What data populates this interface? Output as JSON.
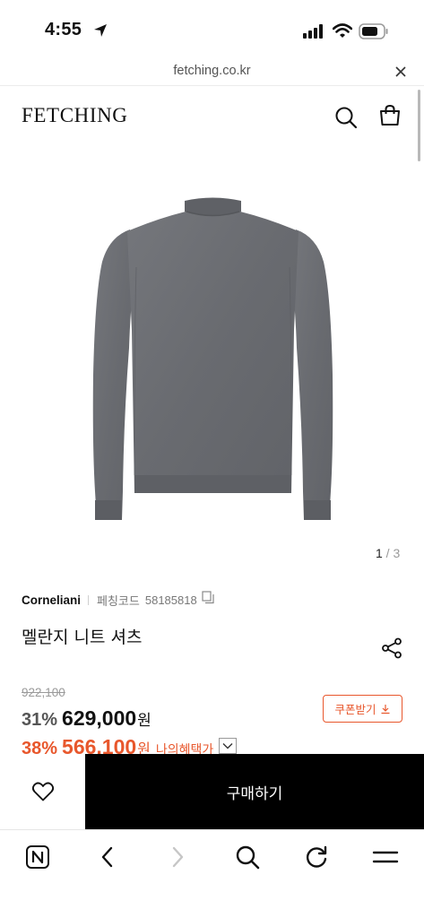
{
  "status_bar": {
    "time": "4:55",
    "icons": [
      "location-arrow-icon",
      "cellular-signal-icon",
      "wifi-icon",
      "battery-icon"
    ]
  },
  "browser": {
    "url": "fetching.co.kr",
    "close_icon": "close-icon"
  },
  "header": {
    "logo": "FETCHING",
    "icons": [
      "search-icon",
      "shopping-bag-icon"
    ]
  },
  "gallery": {
    "current": "1",
    "separator": " / ",
    "total": "3"
  },
  "product": {
    "brand": "Corneliani",
    "code_label": "페칭코드",
    "code": "58185818",
    "name": "멜란지 니트 셔츠",
    "original_price": "922,100",
    "discount_rate": "31%",
    "sale_price": "629,000",
    "currency": "원",
    "coupon_label": "쿠폰받기",
    "benefit_rate": "38%",
    "benefit_price": "566,100",
    "benefit_currency": "원",
    "benefit_label": "나의혜택가"
  },
  "actions": {
    "buy_label": "구매하기"
  },
  "colors": {
    "accent": "#e8572c",
    "buy_button": "#000000",
    "sweater": "#6b6d72"
  }
}
